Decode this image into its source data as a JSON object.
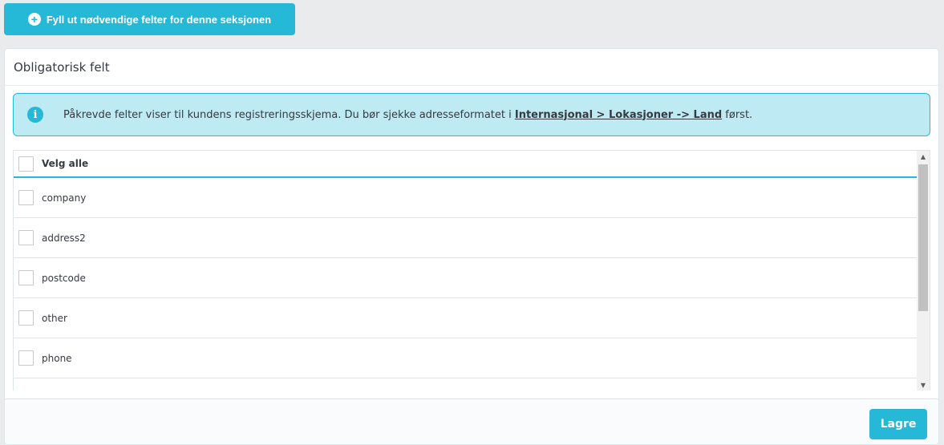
{
  "top_button": {
    "icon": "plus-circle-icon",
    "label": "Fyll ut nødvendige felter for denne seksjonen"
  },
  "panel": {
    "title": "Obligatorisk felt",
    "alert": {
      "icon": "info-icon",
      "text_before": "Påkrevde felter viser til kundens registreringsskjema. Du bør sjekke adresseformatet i ",
      "link": "Internasjonal > Lokasjoner -> Land",
      "text_after": " først."
    },
    "table": {
      "select_all": "Velg alle",
      "rows": [
        "company",
        "address2",
        "postcode",
        "other",
        "phone"
      ]
    },
    "save_label": "Lagre"
  },
  "colors": {
    "accent": "#25b9d7",
    "alert_bg": "#beeaf3"
  }
}
